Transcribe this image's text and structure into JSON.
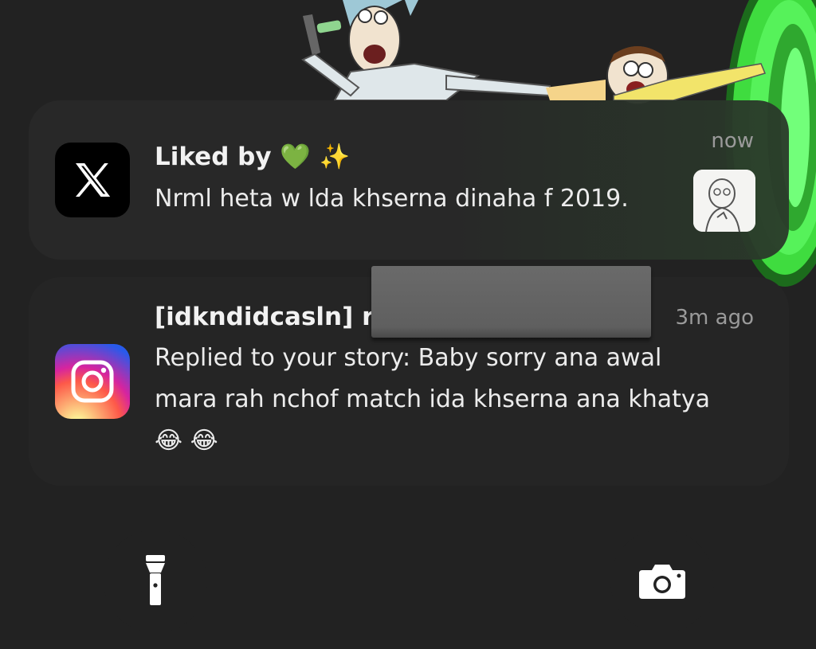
{
  "notifications": [
    {
      "app": "X",
      "app_icon": "x-logo-icon",
      "title": "Liked by 💚 ✨",
      "body": "Nrml heta w lda khserna dinaha f 2019.",
      "time": "now",
      "thumbnail_icon": "meme-thumbnail"
    },
    {
      "app": "Instagram",
      "app_icon": "instagram-logo-icon",
      "title": "[idkndidcasln] r",
      "body": "Replied to your story: Baby sorry ana awal mara rah nchof match ida khserna ana khatya 😂 😂",
      "time": "3m ago"
    }
  ],
  "quick_actions": [
    {
      "icon": "flashlight-icon"
    },
    {
      "icon": "camera-icon"
    }
  ],
  "colors": {
    "background": "#222222",
    "portal_green": "#39e639",
    "time_text": "#9a9a9a"
  }
}
